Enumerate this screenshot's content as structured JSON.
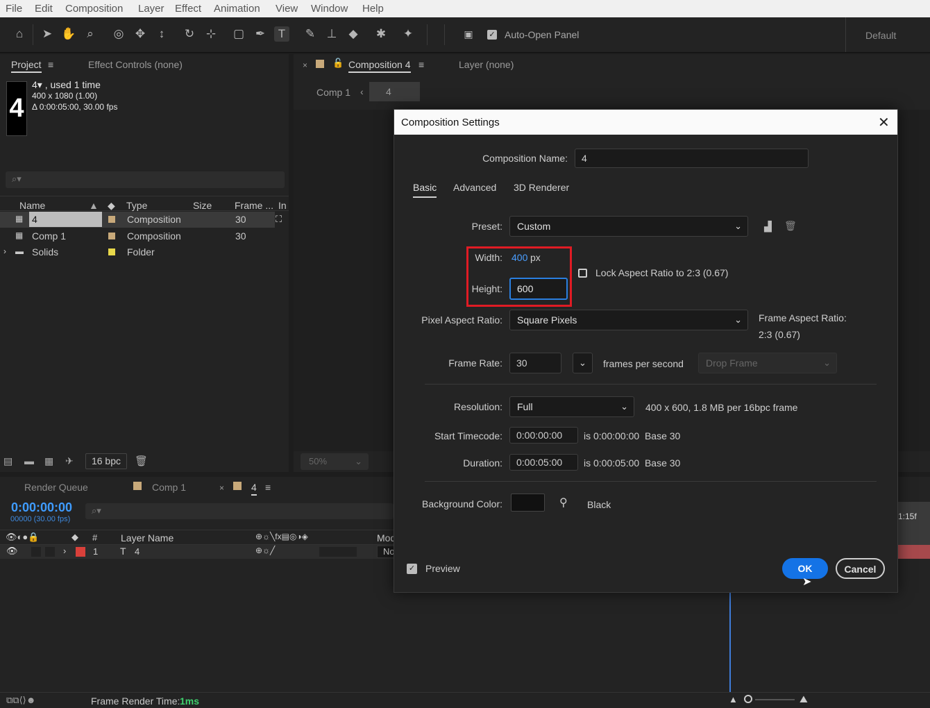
{
  "menu": [
    "File",
    "Edit",
    "Composition",
    "Layer",
    "Effect",
    "Animation",
    "View",
    "Window",
    "Help"
  ],
  "toolbar": {
    "auto_open_panel": "Auto-Open Panel",
    "workspace": "Default"
  },
  "project_panel": {
    "tab_project": "Project",
    "tab_effect_controls": "Effect Controls (none)",
    "thumb_char": "4",
    "info_name": "4▾ , used 1 time",
    "info_size": "400 x 1080 (1.00)",
    "info_duration": "Δ 0:00:05:00, 30.00 fps",
    "columns": {
      "name": "Name",
      "type": "Type",
      "size": "Size",
      "frame": "Frame ...",
      "in": "In"
    },
    "items": [
      {
        "name": "4",
        "type": "Composition",
        "frame": "30",
        "swatch": "#c8a97a"
      },
      {
        "name": "Comp 1",
        "type": "Composition",
        "frame": "30",
        "swatch": "#c8a97a"
      },
      {
        "name": "Solids",
        "type": "Folder",
        "frame": "",
        "swatch": "#e8d84a"
      }
    ],
    "bpc": "16 bpc"
  },
  "comp_panel": {
    "tab_composition": "Composition 4",
    "tab_layer": "Layer (none)",
    "breadcrumb_comp1": "Comp 1",
    "breadcrumb_current": "4",
    "zoom": "50%"
  },
  "timeline": {
    "tab_render_queue": "Render Queue",
    "tab_comp1": "Comp 1",
    "tab_current": "4",
    "timecode": "0:00:00:00",
    "frames": "00000 (30.00 fps)",
    "col_num": "#",
    "col_layer_name": "Layer Name",
    "col_mode": "Mod",
    "layer_index": "1",
    "layer_name": "4",
    "layer_mode": "No",
    "ruler_label": "1:15f",
    "frame_render_label": "Frame Render Time:",
    "frame_render_value": "1ms"
  },
  "dialog": {
    "title": "Composition Settings",
    "comp_name_label": "Composition Name:",
    "comp_name_value": "4",
    "tabs": [
      "Basic",
      "Advanced",
      "3D Renderer"
    ],
    "preset_label": "Preset:",
    "preset_value": "Custom",
    "width_label": "Width:",
    "width_value": "400",
    "width_unit": "px",
    "height_label": "Height:",
    "height_value": "600",
    "lock_label": "Lock Aspect Ratio to 2:3 (0.67)",
    "par_label": "Pixel Aspect Ratio:",
    "par_value": "Square Pixels",
    "far_label": "Frame Aspect Ratio:",
    "far_value": "2:3 (0.67)",
    "frame_rate_label": "Frame Rate:",
    "frame_rate_value": "30",
    "fps_label": "frames per second",
    "drop_frame": "Drop Frame",
    "resolution_label": "Resolution:",
    "resolution_value": "Full",
    "resolution_info": "400 x 600, 1.8 MB per 16bpc frame",
    "start_tc_label": "Start Timecode:",
    "start_tc_value": "0:00:00:00",
    "start_tc_info": "is 0:00:00:00  Base 30",
    "duration_label": "Duration:",
    "duration_value": "0:00:05:00",
    "duration_info": "is 0:00:05:00  Base 30",
    "bg_label": "Background Color:",
    "bg_name": "Black",
    "bg_color": "#111111",
    "preview_label": "Preview",
    "ok": "OK",
    "cancel": "Cancel"
  },
  "colors": {
    "accent": "#2a7fe0",
    "highlight_box": "#e01b24",
    "link_blue": "#4a9eff",
    "timecode_blue": "#3f9cff"
  }
}
